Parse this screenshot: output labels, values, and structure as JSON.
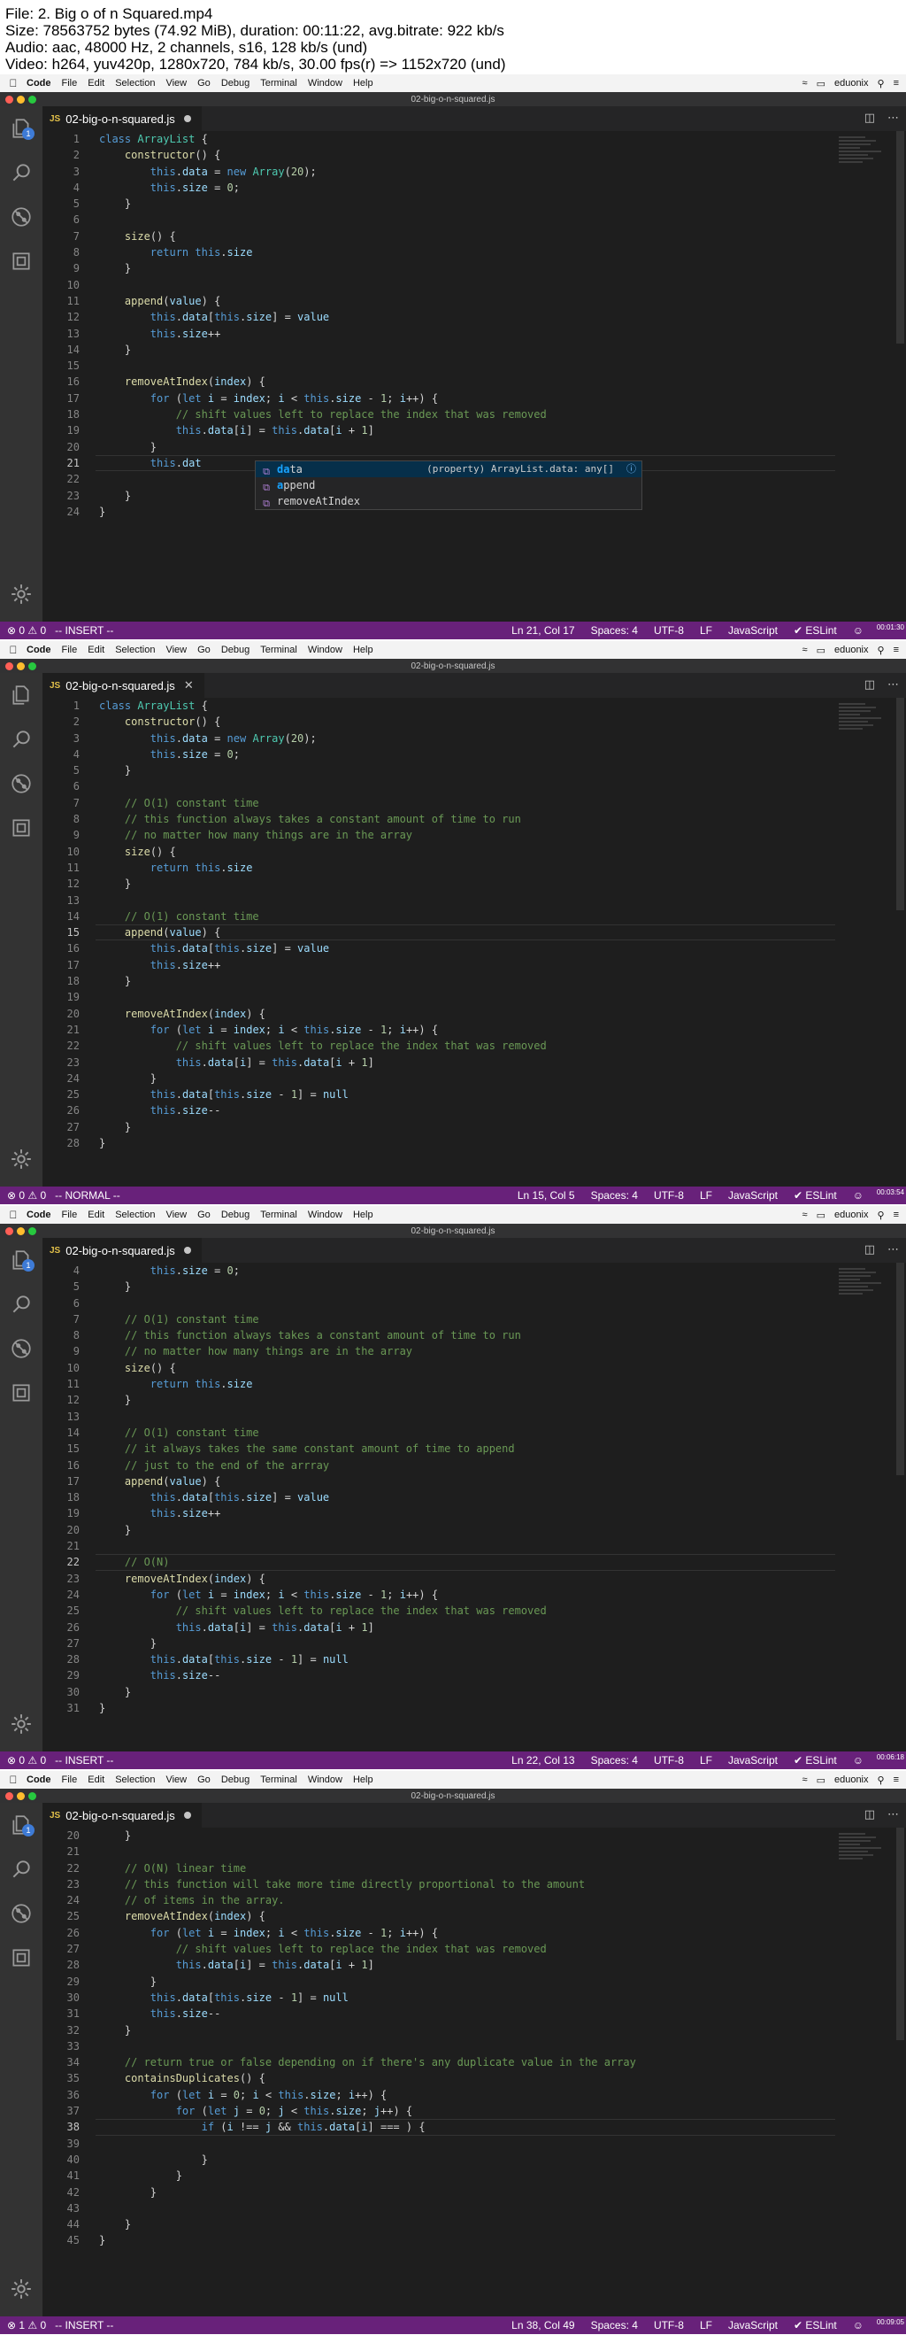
{
  "header": {
    "lines": [
      "File: 2. Big o of n Squared.mp4",
      "Size: 78563752 bytes (74.92 MiB), duration: 00:11:22, avg.bitrate: 922 kb/s",
      "Audio: aac, 48000 Hz, 2 channels, s16, 128 kb/s (und)",
      "Video: h264, yuv420p, 1280x720, 784 kb/s, 30.00 fps(r) => 1152x720 (und)"
    ]
  },
  "menubar": {
    "app": "Code",
    "items": [
      "File",
      "Edit",
      "Selection",
      "View",
      "Go",
      "Debug",
      "Terminal",
      "Window",
      "Help"
    ],
    "user": "eduonix"
  },
  "colors": {
    "statusbar": "#68217a",
    "keyword": "#569cd6",
    "class": "#4ec9b0",
    "function": "#dcdcaa",
    "comment": "#6a9955",
    "number": "#b5cea8"
  },
  "frames": [
    {
      "title": "02-big-o-n-squared.js",
      "tab": {
        "name": "02-big-o-n-squared.js",
        "dirty": true
      },
      "scm_badge": "1",
      "lines": [
        {
          "n": "1",
          "t": "class ArrayList {"
        },
        {
          "n": "2",
          "t": "    constructor() {"
        },
        {
          "n": "3",
          "t": "        this.data = new Array(20);"
        },
        {
          "n": "4",
          "t": "        this.size = 0;"
        },
        {
          "n": "5",
          "t": "    }"
        },
        {
          "n": "6",
          "t": ""
        },
        {
          "n": "7",
          "t": "    size() {"
        },
        {
          "n": "8",
          "t": "        return this.size"
        },
        {
          "n": "9",
          "t": "    }"
        },
        {
          "n": "10",
          "t": ""
        },
        {
          "n": "11",
          "t": "    append(value) {"
        },
        {
          "n": "12",
          "t": "        this.data[this.size] = value"
        },
        {
          "n": "13",
          "t": "        this.size++"
        },
        {
          "n": "14",
          "t": "    }"
        },
        {
          "n": "15",
          "t": ""
        },
        {
          "n": "16",
          "t": "    removeAtIndex(index) {"
        },
        {
          "n": "17",
          "t": "        for (let i = index; i < this.size - 1; i++) {"
        },
        {
          "n": "18",
          "t": "            // shift values left to replace the index that was removed"
        },
        {
          "n": "19",
          "t": "            this.data[i] = this.data[i + 1]"
        },
        {
          "n": "20",
          "t": "        }"
        },
        {
          "n": "21",
          "t": "        this.dat",
          "active": true
        },
        {
          "n": "22",
          "t": ""
        },
        {
          "n": "23",
          "t": "    }"
        },
        {
          "n": "24",
          "t": "}"
        }
      ],
      "suggest": {
        "items": [
          {
            "hl": "da",
            "rest": "ta",
            "detail": "(property) ArrayList.data: any[]",
            "selected": true
          },
          {
            "hl": "a",
            "rest": "ppend",
            "detail": ""
          },
          {
            "hl": "",
            "rest": "removeAtIndex",
            "detail": ""
          }
        ]
      },
      "status": {
        "errors": "0",
        "warnings": "0",
        "mode": "-- INSERT --",
        "position": "Ln 21, Col 17",
        "spaces": "Spaces: 4",
        "encoding": "UTF-8",
        "eol": "LF",
        "language": "JavaScript",
        "linter": "ESLint",
        "timestamp": "00:01:30"
      }
    },
    {
      "title": "02-big-o-n-squared.js",
      "tab": {
        "name": "02-big-o-n-squared.js",
        "dirty": false
      },
      "scm_badge": "",
      "lines": [
        {
          "n": "1",
          "t": "class ArrayList {"
        },
        {
          "n": "2",
          "t": "    constructor() {"
        },
        {
          "n": "3",
          "t": "        this.data = new Array(20);"
        },
        {
          "n": "4",
          "t": "        this.size = 0;"
        },
        {
          "n": "5",
          "t": "    }"
        },
        {
          "n": "6",
          "t": ""
        },
        {
          "n": "7",
          "t": "    // O(1) constant time"
        },
        {
          "n": "8",
          "t": "    // this function always takes a constant amount of time to run"
        },
        {
          "n": "9",
          "t": "    // no matter how many things are in the array"
        },
        {
          "n": "10",
          "t": "    size() {"
        },
        {
          "n": "11",
          "t": "        return this.size"
        },
        {
          "n": "12",
          "t": "    }"
        },
        {
          "n": "13",
          "t": ""
        },
        {
          "n": "14",
          "t": "    // O(1) constant time"
        },
        {
          "n": "15",
          "t": "    append(value) {",
          "active": true
        },
        {
          "n": "16",
          "t": "        this.data[this.size] = value"
        },
        {
          "n": "17",
          "t": "        this.size++"
        },
        {
          "n": "18",
          "t": "    }"
        },
        {
          "n": "19",
          "t": ""
        },
        {
          "n": "20",
          "t": "    removeAtIndex(index) {"
        },
        {
          "n": "21",
          "t": "        for (let i = index; i < this.size - 1; i++) {"
        },
        {
          "n": "22",
          "t": "            // shift values left to replace the index that was removed"
        },
        {
          "n": "23",
          "t": "            this.data[i] = this.data[i + 1]"
        },
        {
          "n": "24",
          "t": "        }"
        },
        {
          "n": "25",
          "t": "        this.data[this.size - 1] = null"
        },
        {
          "n": "26",
          "t": "        this.size--"
        },
        {
          "n": "27",
          "t": "    }"
        },
        {
          "n": "28",
          "t": "}"
        }
      ],
      "status": {
        "errors": "0",
        "warnings": "0",
        "mode": "-- NORMAL --",
        "position": "Ln 15, Col 5",
        "spaces": "Spaces: 4",
        "encoding": "UTF-8",
        "eol": "LF",
        "language": "JavaScript",
        "linter": "ESLint",
        "timestamp": "00:03:54"
      }
    },
    {
      "title": "02-big-o-n-squared.js",
      "tab": {
        "name": "02-big-o-n-squared.js",
        "dirty": true
      },
      "scm_badge": "1",
      "lines": [
        {
          "n": "4",
          "t": "        this.size = 0;"
        },
        {
          "n": "5",
          "t": "    }"
        },
        {
          "n": "6",
          "t": ""
        },
        {
          "n": "7",
          "t": "    // O(1) constant time"
        },
        {
          "n": "8",
          "t": "    // this function always takes a constant amount of time to run"
        },
        {
          "n": "9",
          "t": "    // no matter how many things are in the array"
        },
        {
          "n": "10",
          "t": "    size() {"
        },
        {
          "n": "11",
          "t": "        return this.size"
        },
        {
          "n": "12",
          "t": "    }"
        },
        {
          "n": "13",
          "t": ""
        },
        {
          "n": "14",
          "t": "    // O(1) constant time"
        },
        {
          "n": "15",
          "t": "    // it always takes the same constant amount of time to append"
        },
        {
          "n": "16",
          "t": "    // just to the end of the arrray"
        },
        {
          "n": "17",
          "t": "    append(value) {"
        },
        {
          "n": "18",
          "t": "        this.data[this.size] = value"
        },
        {
          "n": "19",
          "t": "        this.size++"
        },
        {
          "n": "20",
          "t": "    }"
        },
        {
          "n": "21",
          "t": ""
        },
        {
          "n": "22",
          "t": "    // O(N) ",
          "active": true
        },
        {
          "n": "23",
          "t": "    removeAtIndex(index) {"
        },
        {
          "n": "24",
          "t": "        for (let i = index; i < this.size - 1; i++) {"
        },
        {
          "n": "25",
          "t": "            // shift values left to replace the index that was removed"
        },
        {
          "n": "26",
          "t": "            this.data[i] = this.data[i + 1]"
        },
        {
          "n": "27",
          "t": "        }"
        },
        {
          "n": "28",
          "t": "        this.data[this.size - 1] = null"
        },
        {
          "n": "29",
          "t": "        this.size--"
        },
        {
          "n": "30",
          "t": "    }"
        },
        {
          "n": "31",
          "t": "}"
        }
      ],
      "status": {
        "errors": "0",
        "warnings": "0",
        "mode": "-- INSERT --",
        "position": "Ln 22, Col 13",
        "spaces": "Spaces: 4",
        "encoding": "UTF-8",
        "eol": "LF",
        "language": "JavaScript",
        "linter": "ESLint",
        "timestamp": "00:06:18"
      }
    },
    {
      "title": "02-big-o-n-squared.js",
      "tab": {
        "name": "02-big-o-n-squared.js",
        "dirty": true
      },
      "scm_badge": "1",
      "lines": [
        {
          "n": "20",
          "t": "    }"
        },
        {
          "n": "21",
          "t": ""
        },
        {
          "n": "22",
          "t": "    // O(N) linear time"
        },
        {
          "n": "23",
          "t": "    // this function will take more time directly proportional to the amount"
        },
        {
          "n": "24",
          "t": "    // of items in the array."
        },
        {
          "n": "25",
          "t": "    removeAtIndex(index) {"
        },
        {
          "n": "26",
          "t": "        for (let i = index; i < this.size - 1; i++) {"
        },
        {
          "n": "27",
          "t": "            // shift values left to replace the index that was removed"
        },
        {
          "n": "28",
          "t": "            this.data[i] = this.data[i + 1]"
        },
        {
          "n": "29",
          "t": "        }"
        },
        {
          "n": "30",
          "t": "        this.data[this.size - 1] = null"
        },
        {
          "n": "31",
          "t": "        this.size--"
        },
        {
          "n": "32",
          "t": "    }"
        },
        {
          "n": "33",
          "t": ""
        },
        {
          "n": "34",
          "t": "    // return true or false depending on if there's any duplicate value in the array"
        },
        {
          "n": "35",
          "t": "    containsDuplicates() {"
        },
        {
          "n": "36",
          "t": "        for (let i = 0; i < this.size; i++) {"
        },
        {
          "n": "37",
          "t": "            for (let j = 0; j < this.size; j++) {"
        },
        {
          "n": "38",
          "t": "                if (i !== j && this.data[i] === ) {",
          "active": true
        },
        {
          "n": "39",
          "t": ""
        },
        {
          "n": "40",
          "t": "                }"
        },
        {
          "n": "41",
          "t": "            }"
        },
        {
          "n": "42",
          "t": "        }"
        },
        {
          "n": "43",
          "t": ""
        },
        {
          "n": "44",
          "t": "    }"
        },
        {
          "n": "45",
          "t": "}"
        }
      ],
      "status": {
        "errors": "1",
        "warnings": "0",
        "mode": "-- INSERT --",
        "position": "Ln 38, Col 49",
        "spaces": "Spaces: 4",
        "encoding": "UTF-8",
        "eol": "LF",
        "language": "JavaScript",
        "linter": "ESLint",
        "timestamp": "00:09:05"
      }
    }
  ]
}
